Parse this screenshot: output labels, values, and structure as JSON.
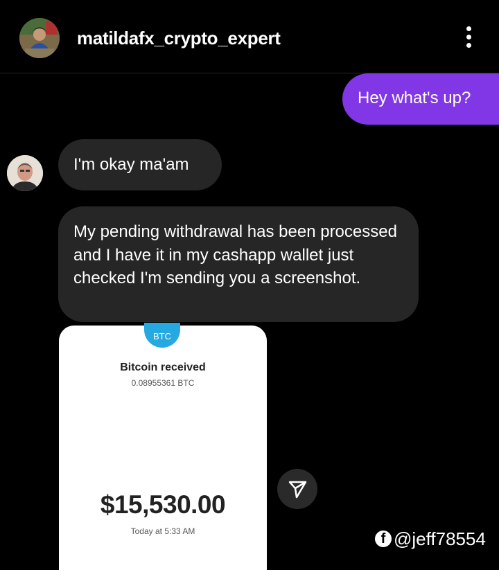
{
  "header": {
    "username": "matildafx_crypto_expert",
    "avatar_icon": "profile-photo-icon",
    "menu_icon": "more-vertical-icon"
  },
  "messages": [
    {
      "direction": "outgoing",
      "text": "Hey what's up?"
    },
    {
      "direction": "incoming",
      "text": "I'm okay ma'am"
    },
    {
      "direction": "incoming",
      "text": "My pending withdrawal has been processed and I have it in my cashapp wallet just checked I'm sending you a screenshot."
    }
  ],
  "receipt": {
    "badge": "BTC",
    "title": "Bitcoin received",
    "btc_amount": "0.08955361 BTC",
    "usd_amount": "$15,530.00",
    "time": "Today at 5:33 AM"
  },
  "share_icon": "send-icon",
  "watermark": {
    "icon": "facebook-icon",
    "handle": "@jeff78554"
  },
  "colors": {
    "background": "#000000",
    "outgoing_bubble": "#8237e6",
    "incoming_bubble": "#262626",
    "btc_badge": "#26a9e0"
  }
}
